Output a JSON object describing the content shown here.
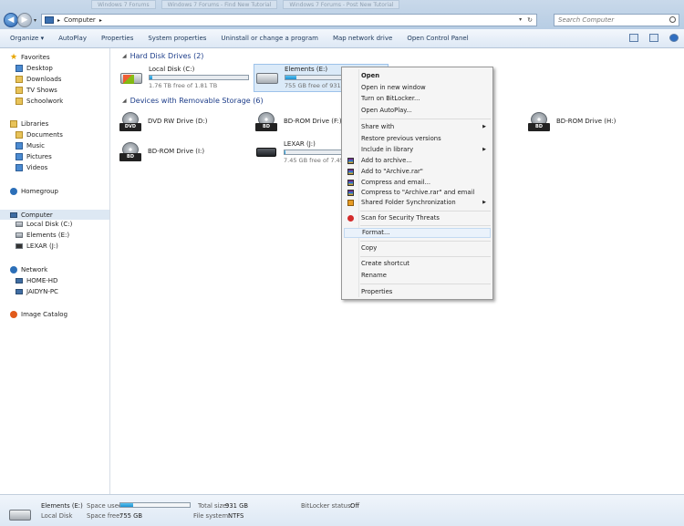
{
  "title_tabs": [
    "Windows 7 Forums",
    "Windows 7 Forums - Find New Tutorial",
    "Windows 7 Forums - Post New Tutorial"
  ],
  "address": {
    "segment": "Computer"
  },
  "search": {
    "placeholder": "Search Computer"
  },
  "toolbar": {
    "items": [
      "Organize ▾",
      "AutoPlay",
      "Properties",
      "System properties",
      "Uninstall or change a program",
      "Map network drive",
      "Open Control Panel"
    ]
  },
  "nav": {
    "favorites": {
      "label": "Favorites",
      "items": [
        "Desktop",
        "Downloads",
        "TV Shows",
        "Schoolwork"
      ]
    },
    "libraries": {
      "label": "Libraries",
      "items": [
        "Documents",
        "Music",
        "Pictures",
        "Videos"
      ]
    },
    "homegroup": "Homegroup",
    "computer": {
      "label": "Computer",
      "items": [
        "Local Disk (C:)",
        "Elements (E:)",
        "LEXAR (J:)"
      ]
    },
    "network": {
      "label": "Network",
      "items": [
        "HOME-HD",
        "JAIDYN-PC"
      ]
    },
    "image_catalog": "Image Catalog"
  },
  "sections": {
    "hard_disk": "Hard Disk Drives (2)",
    "removable": "Devices with Removable Storage (6)"
  },
  "drives": {
    "c": {
      "name": "Local Disk (C:)",
      "free": "1.76 TB free of 1.81 TB",
      "used_fraction": 0.03
    },
    "e": {
      "name": "Elements (E:)",
      "free": "755 GB free of 931 GB",
      "used_fraction": 0.19
    },
    "d": {
      "name": "DVD RW Drive (D:)",
      "badge": "DVD"
    },
    "f": {
      "name": "BD-ROM Drive (F:)",
      "badge": "BD"
    },
    "h": {
      "name": "BD-ROM Drive (H:)",
      "badge": "BD"
    },
    "i": {
      "name": "BD-ROM Drive (I:)",
      "badge": "BD"
    },
    "j": {
      "name": "LEXAR (J:)",
      "free": "7.45 GB free of 7.45 GB",
      "used_fraction": 0.01
    }
  },
  "context_menu": {
    "open": "Open",
    "open_new_window": "Open in new window",
    "bitlocker": "Turn on BitLocker...",
    "autoplay": "Open AutoPlay...",
    "share_with": "Share with",
    "restore": "Restore previous versions",
    "include_library": "Include in library",
    "add_archive": "Add to archive...",
    "add_archive_rar": "Add to \"Archive.rar\"",
    "compress_email": "Compress and email...",
    "compress_rar_email": "Compress to \"Archive.rar\" and email",
    "shared_folder_sync": "Shared Folder Synchronization",
    "scan": "Scan for Security Threats",
    "format": "Format...",
    "copy": "Copy",
    "create_shortcut": "Create shortcut",
    "rename": "Rename",
    "properties": "Properties"
  },
  "statusbar": {
    "name": "Elements (E:)",
    "type": "Local Disk",
    "space_used_label": "Space used:",
    "space_used_fraction": 0.19,
    "space_free_label": "Space free:",
    "space_free": "755 GB",
    "total_size_label": "Total size:",
    "total_size": "931 GB",
    "file_system_label": "File system:",
    "file_system": "NTFS",
    "bitlocker_label": "BitLocker status:",
    "bitlocker": "Off"
  }
}
